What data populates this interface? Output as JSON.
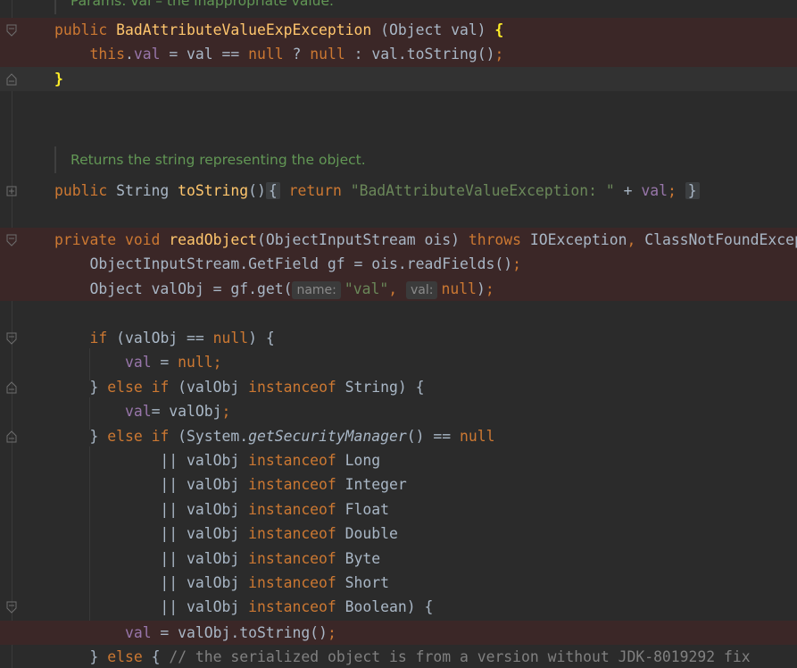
{
  "doc_comments": {
    "params": "Params: val – the inappropriate value.",
    "returns": "Returns the string representing the object."
  },
  "code": {
    "l1": {
      "public": "public",
      "name": "BadAttributeValueExpException",
      "args": " (Object val) ",
      "brace": "{"
    },
    "l2": {
      "this": "this",
      "dot": ".",
      "val": "val",
      "mid": " = val == ",
      "null1": "null",
      "q": " ? ",
      "null2": "null",
      "tail": " : val.toString()",
      "semi": ";"
    },
    "l3": {
      "brace": "}"
    },
    "l4": {
      "public": "public",
      "type": " String ",
      "name": "toString",
      "parens": "()",
      "fold_open": "{",
      "return": " return ",
      "str": "\"BadAttributeValueException: \"",
      "plus": " + ",
      "val": "val",
      "semi": ";",
      "fold_close": "}"
    },
    "l5": {
      "private": "private",
      "void": " void ",
      "name": "readObject",
      "args": "(ObjectInputStream ois) ",
      "throws": "throws",
      "exc": " IOException",
      "comma": ",",
      "exc2": " ClassNotFoundException {"
    },
    "l6": {
      "text": "ObjectInputStream.GetField gf = ois.readFields()",
      "semi": ";"
    },
    "l7": {
      "pre": "Object valObj = gf.get(",
      "hint_name": "name:",
      "str": "\"val\"",
      "comma": ", ",
      "hint_val": "val:",
      "null": "null",
      "tail": ")",
      "semi": ";"
    },
    "l8": {
      "if": "if",
      "mid": " (valObj == ",
      "null": "null",
      "tail": ") {"
    },
    "l9": {
      "val": "val",
      "mid": " = ",
      "null": "null",
      "semi": ";"
    },
    "l10": {
      "brace": "} ",
      "else": "else if",
      "mid": " (valObj ",
      "instanceof": "instanceof",
      "tail": " String) {"
    },
    "l11": {
      "val": "val",
      "mid": "= valObj",
      "semi": ";"
    },
    "l12": {
      "brace": "} ",
      "else": "else if",
      "mid": " (System.",
      "method": "getSecurityManager",
      "tail": "() == ",
      "null": "null"
    },
    "or_lines": [
      {
        "pre": "|| valObj ",
        "kw": "instanceof",
        "type": " Long"
      },
      {
        "pre": "|| valObj ",
        "kw": "instanceof",
        "type": " Integer"
      },
      {
        "pre": "|| valObj ",
        "kw": "instanceof",
        "type": " Float"
      },
      {
        "pre": "|| valObj ",
        "kw": "instanceof",
        "type": " Double"
      },
      {
        "pre": "|| valObj ",
        "kw": "instanceof",
        "type": " Byte"
      },
      {
        "pre": "|| valObj ",
        "kw": "instanceof",
        "type": " Short"
      },
      {
        "pre": "|| valObj ",
        "kw": "instanceof",
        "type": " Boolean) {"
      }
    ],
    "l20": {
      "val": "val",
      "mid": " = valObj.toString()",
      "semi": ";"
    },
    "l21": {
      "brace": "} ",
      "else": "else",
      "mid": " { ",
      "comment": "// the serialized object is from a version without JDK-8019292 fix"
    }
  },
  "colors": {
    "background": "#2b2b2b",
    "keyword": "#cc7832",
    "method": "#ffc66d",
    "field": "#9876aa",
    "string": "#6a8759",
    "doc": "#629755",
    "error_line": "#3b2727"
  },
  "icons": [
    "fold-icon",
    "unfold-icon"
  ]
}
